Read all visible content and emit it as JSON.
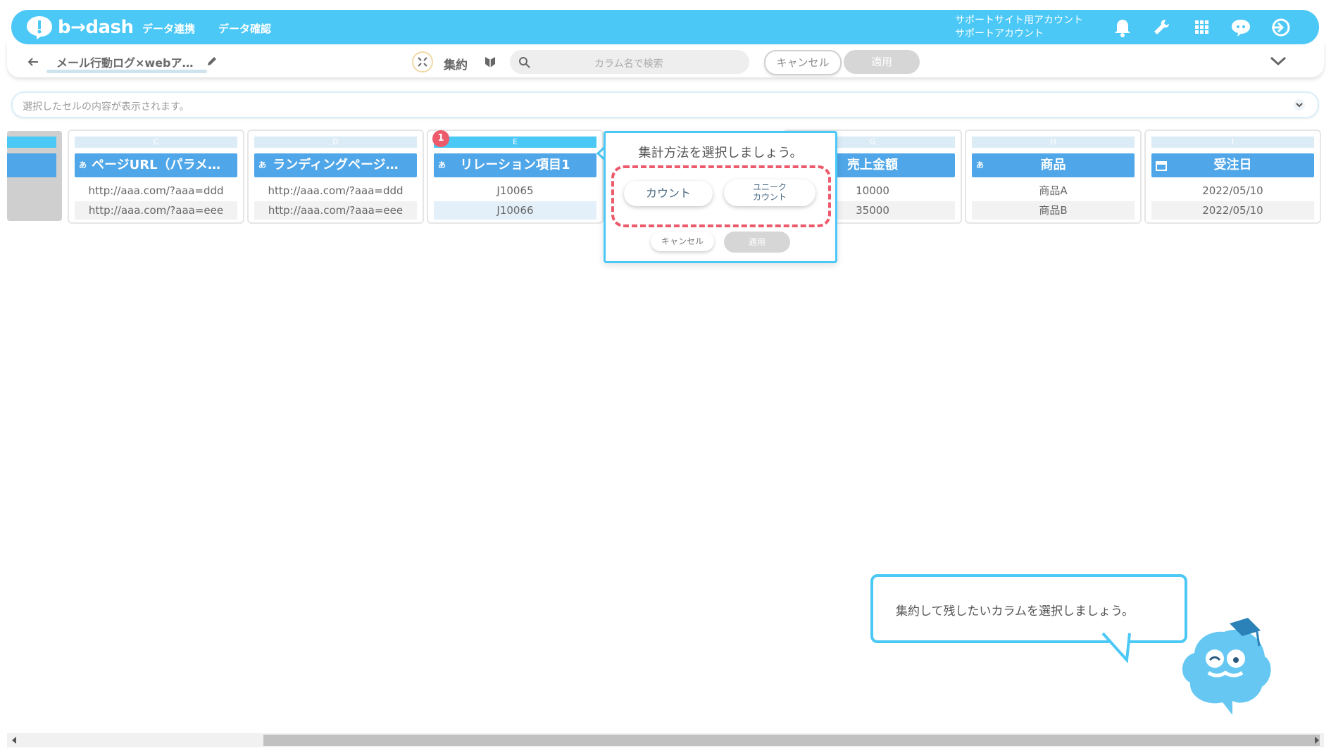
{
  "app": {
    "logo_text": "b→dash",
    "nav": [
      "データ連携",
      "データ確認"
    ],
    "account_line1": "サポートサイト用アカウント",
    "account_line2": "サポートアカウント",
    "icons": [
      "bell-icon",
      "wrench-icon",
      "grid-icon",
      "chat-bot-icon",
      "logout-icon"
    ]
  },
  "toolbar": {
    "title": "メール行動ログ×webア…",
    "mode_label": "集約",
    "search_placeholder": "カラム名で検索",
    "cancel_label": "キャンセル",
    "apply_label": "適用"
  },
  "cell_bar": {
    "text": "選択したセルの内容が表示されます。"
  },
  "columns": [
    {
      "letter": "C",
      "type": "あ",
      "name": "ページURL（パラメ…",
      "rows": [
        "http://aaa.com/?aaa=ddd",
        "http://aaa.com/?aaa=eee"
      ]
    },
    {
      "letter": "D",
      "type": "あ",
      "name": "ランディングページ…",
      "rows": [
        "http://aaa.com/?aaa=ddd",
        "http://aaa.com/?aaa=eee"
      ]
    },
    {
      "letter": "E",
      "type": "あ",
      "name": "リレーション項目1",
      "rows": [
        "J10065",
        "J10066"
      ],
      "badge": "1"
    },
    {
      "letter": "G",
      "type": "",
      "name": "売上金額",
      "rows": [
        "10000",
        "35000"
      ]
    },
    {
      "letter": "H",
      "type": "あ",
      "name": "商品",
      "rows": [
        "商品A",
        "商品B"
      ]
    },
    {
      "letter": "I",
      "type": "",
      "name": "受注日",
      "rows": [
        "2022/05/10",
        "2022/05/10"
      ]
    }
  ],
  "popup": {
    "title": "集計方法を選択しましょう。",
    "count_label": "カウント",
    "unique_line1": "ユニーク",
    "unique_line2": "カウント",
    "cancel_label": "キャンセル",
    "apply_label": "適用"
  },
  "guide": {
    "text": "集約して残したいカラムを選択しましょう。"
  },
  "colors": {
    "brand": "#4bc8f6",
    "header": "#4fa6e8",
    "highlight": "#ec5a6c"
  }
}
